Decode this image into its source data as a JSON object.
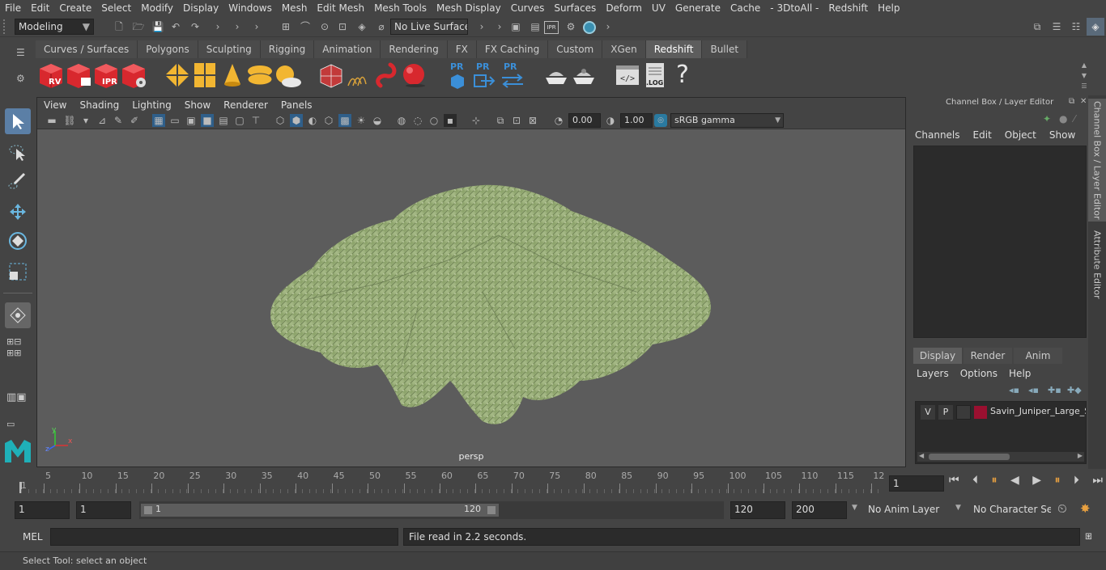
{
  "menubar": {
    "items": [
      "File",
      "Edit",
      "Create",
      "Select",
      "Modify",
      "Display",
      "Windows",
      "Mesh",
      "Edit Mesh",
      "Mesh Tools",
      "Mesh Display",
      "Curves",
      "Surfaces",
      "Deform",
      "UV",
      "Generate",
      "Cache",
      "- 3DtoAll -",
      "Redshift",
      "Help"
    ]
  },
  "status": {
    "mode": "Modeling",
    "live_surface": "No Live Surface"
  },
  "shelf": {
    "tabs": [
      "Curves / Surfaces",
      "Polygons",
      "Sculpting",
      "Rigging",
      "Animation",
      "Rendering",
      "FX",
      "FX Caching",
      "Custom",
      "XGen",
      "Redshift",
      "Bullet"
    ],
    "active_tab": "Redshift",
    "icon_labels": {
      "rv": "RV",
      "ipr": "IPR",
      "pr": "PR",
      "log": ".LOG",
      "help": "?"
    }
  },
  "viewport": {
    "menu": [
      "View",
      "Shading",
      "Lighting",
      "Show",
      "Renderer",
      "Panels"
    ],
    "exposure": "0.00",
    "gamma": "1.00",
    "color_space": "sRGB gamma",
    "camera_label": "persp",
    "axis_labels": {
      "x": "x",
      "y": "y",
      "z": "z"
    }
  },
  "channel_box": {
    "title": "Channel Box / Layer Editor",
    "menu": [
      "Channels",
      "Edit",
      "Object",
      "Show"
    ]
  },
  "layer_editor": {
    "tabs": [
      "Display",
      "Render",
      "Anim"
    ],
    "active_tab": "Display",
    "menu": [
      "Layers",
      "Options",
      "Help"
    ],
    "layers": [
      {
        "v": "V",
        "p": "P",
        "name": "Savin_Juniper_Large_S",
        "color": "#9a1030"
      }
    ]
  },
  "side_tabs": [
    "Channel Box / Layer Editor",
    "Attribute Editor"
  ],
  "timeline": {
    "ticks": [
      "1",
      "5",
      "10",
      "15",
      "20",
      "25",
      "30",
      "35",
      "40",
      "45",
      "50",
      "55",
      "60",
      "65",
      "70",
      "75",
      "80",
      "85",
      "90",
      "95",
      "100",
      "105",
      "110",
      "115",
      "12"
    ],
    "current_frame": "1"
  },
  "range": {
    "start_time": "1",
    "start_range": "1",
    "slider_start": "1",
    "slider_end": "120",
    "end_range": "120",
    "end_time": "200",
    "anim_layer": "No Anim Layer",
    "character_set": "No Character Set"
  },
  "command": {
    "label": "MEL",
    "result": "File read in  2.2 seconds."
  },
  "help_line": "Select Tool: select an object",
  "colors": {
    "accent": "#5d5d5d",
    "redshift_red": "#d8282e",
    "viewport_bg": "#5c5c5c",
    "foliage": "#9ab07a"
  }
}
